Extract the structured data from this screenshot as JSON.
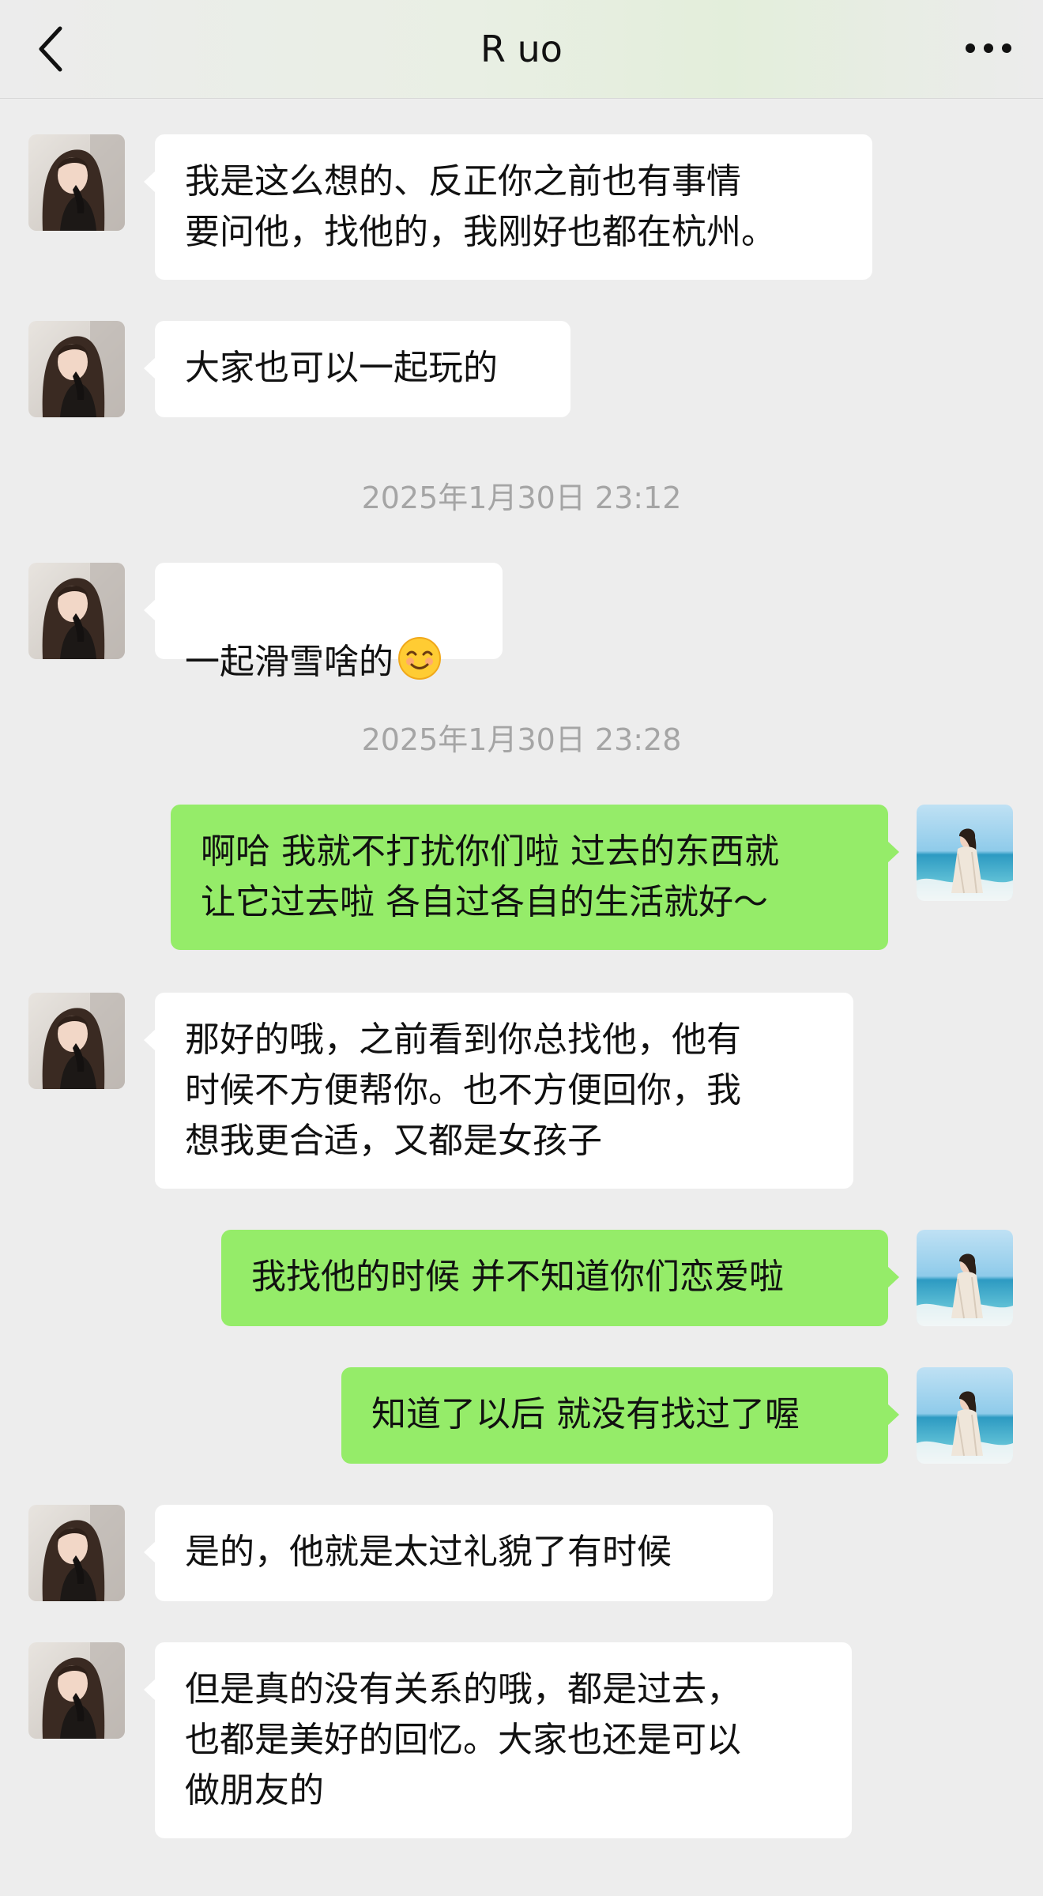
{
  "header": {
    "title": "R uo",
    "back_icon": "chevron-left-icon",
    "more_icon": "more-dots-icon",
    "gradient_accent": "#e3eedb"
  },
  "colors": {
    "background": "#ededed",
    "incoming_bubble": "#ffffff",
    "outgoing_bubble": "#95ec69",
    "timestamp_text": "#a5a5a5"
  },
  "messages": [
    {
      "type": "in",
      "text": "我是这么想的、反正你之前也有事情\n要问他，找他的，我刚好也都在杭州。"
    },
    {
      "type": "in",
      "text": "大家也可以一起玩的"
    },
    {
      "type": "time",
      "text": "2025年1月30日 23:12"
    },
    {
      "type": "in",
      "text": "一起滑雪啥的",
      "emoji": "smiling-face-emoji"
    },
    {
      "type": "time",
      "text": "2025年1月30日 23:28"
    },
    {
      "type": "out",
      "text": "啊哈 我就不打扰你们啦 过去的东西就\n让它过去啦 各自过各自的生活就好～"
    },
    {
      "type": "in",
      "text": "那好的哦，之前看到你总找他，他有\n时候不方便帮你。也不方便回你，我\n想我更合适，又都是女孩子"
    },
    {
      "type": "out",
      "text": "我找他的时候 并不知道你们恋爱啦"
    },
    {
      "type": "out",
      "text": "知道了以后 就没有找过了喔"
    },
    {
      "type": "in",
      "text": "是的，他就是太过礼貌了有时候"
    },
    {
      "type": "in",
      "text": "但是真的没有关系的哦，都是过去，\n也都是美好的回忆。大家也还是可以\n做朋友的"
    }
  ]
}
